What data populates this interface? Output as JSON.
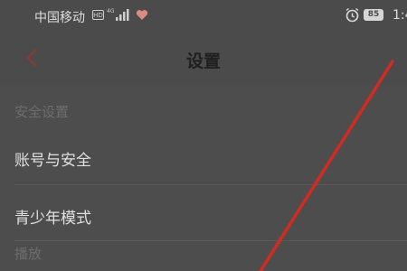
{
  "statusbar": {
    "carrier": "中国移动",
    "hd_badge": "HD",
    "battery_level": "85",
    "time": "1:4"
  },
  "navbar": {
    "back_icon": "chevron-left-icon",
    "title": "设置"
  },
  "settings": {
    "section_security": "安全设置",
    "items": [
      {
        "label": "账号与安全"
      },
      {
        "label": "青少年模式"
      }
    ],
    "section_playback": "播放"
  },
  "colors": {
    "accent": "#c0392b",
    "overlay_line": "#d32a22",
    "background": "#4b4b4b"
  }
}
